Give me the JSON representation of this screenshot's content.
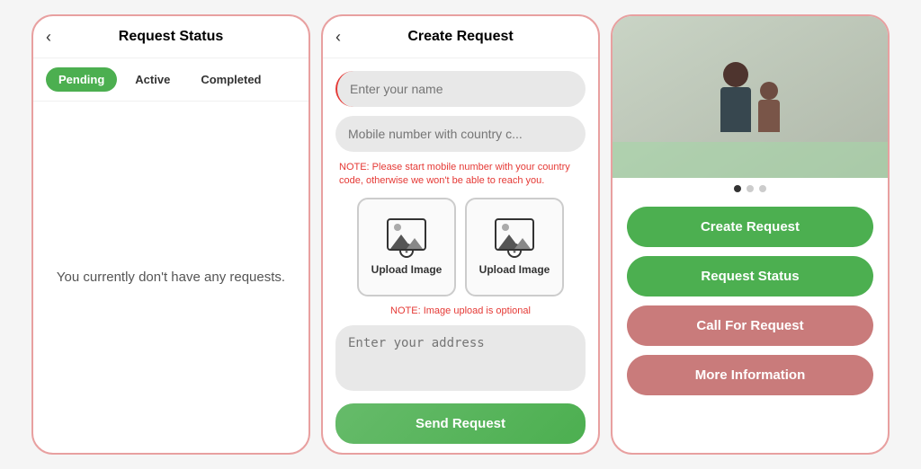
{
  "screen1": {
    "title": "Request Status",
    "tabs": [
      {
        "label": "Pending",
        "state": "active"
      },
      {
        "label": "Active",
        "state": "inactive"
      },
      {
        "label": "Completed",
        "state": "inactive"
      }
    ],
    "empty_message": "You currently don't have any requests."
  },
  "screen2": {
    "title": "Create Request",
    "name_placeholder": "Enter your name",
    "mobile_placeholder": "Mobile number with country c...",
    "mobile_note": "NOTE: Please start mobile number with your country code, otherwise we won't be able to reach you.",
    "upload_label_1": "Upload Image",
    "upload_label_2": "Upload Image",
    "upload_note": "NOTE: Image upload is optional",
    "address_placeholder": "Enter your address",
    "send_button": "Send Request"
  },
  "screen3": {
    "dots": [
      {
        "active": true
      },
      {
        "active": false
      },
      {
        "active": false
      }
    ],
    "buttons": [
      {
        "label": "Create Request",
        "style": "green"
      },
      {
        "label": "Request Status",
        "style": "green"
      },
      {
        "label": "Call For Request",
        "style": "pink"
      },
      {
        "label": "More Information",
        "style": "pink"
      }
    ]
  }
}
